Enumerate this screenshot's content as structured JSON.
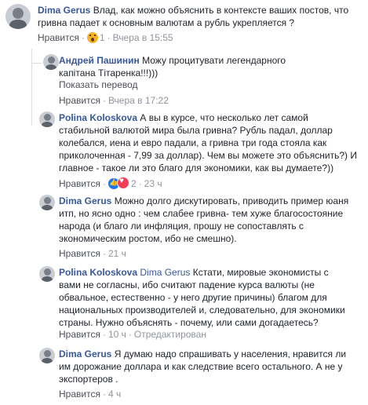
{
  "comments": [
    {
      "author": "Dima Gerus",
      "text": "Влад, как можно объяснить в контексте ваших постов, что гривна падает к основным валютам а рубль укрепляется ?",
      "like_label": "Нравится",
      "reactions_count": "1",
      "reaction_icons": [
        "wow-icon"
      ],
      "time": "Вчера в 15:55"
    },
    {
      "author": "Андрей Пашинин",
      "text": "Можу процитувати легендарного капітана Тітаренка!!!)))",
      "translate_label": "Показать перевод",
      "like_label": "Нравится",
      "time": "Вчера в 17:22"
    },
    {
      "author": "Polina Koloskova",
      "text": "А вы в курсе, что несколько лет самой стабильной валютой мира была гривна? Рубль падал, доллар колебался, иена и евро падали, а гривна три года стояла как приколоченная - 7,99 за доллар). Чем вы можете это объяснить?) И главное - такое ли это благо для экономики, как вы думаете?))",
      "like_label": "Нравится",
      "reactions_count": "2",
      "reaction_icons": [
        "like-icon",
        "heart-icon"
      ],
      "time": "23 ч"
    },
    {
      "author": "Dima Gerus",
      "text": "Можно долго дискутировать, приводить пример юаня итп, но ясно одно : чем слабее гривна- тем хуже благосостояние народа (и благо ли инфляция, прошу не сопоставлять с экономическим ростом, ибо не смешно).",
      "like_label": "Нравится",
      "time": "21 ч"
    },
    {
      "author": "Polina Koloskova",
      "mention": "Dima Gerus",
      "text": "Кстати, мировые экономисты с вами не согласны, ибо считают падение курса валюты (не обвальное, естественно - у него другие причины) благом для национальных производителей и, следовательно, для экономики страны. Нужно объяснять - почему, или сами догадаетесь?",
      "like_label": "Нравится",
      "time": "10 ч",
      "edited_label": "Отредактирован"
    },
    {
      "author": "Dima Gerus",
      "text": "Я думаю надо спрашивать у населения, нравится ли им дорожание доллара и как следствие всего остального. А не у экспортеров .",
      "like_label": "Нравится",
      "time": "4 ч"
    }
  ],
  "colors": {
    "author": "#385898",
    "text": "#1d2129",
    "meta": "#90949c",
    "separator": "#dadde1"
  }
}
